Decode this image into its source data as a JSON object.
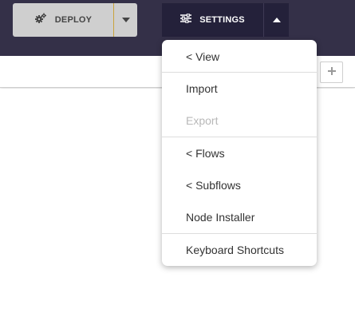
{
  "header": {
    "deploy": {
      "label": "DEPLOY",
      "icon": "gears-icon",
      "caret_icon": "caret-down-icon"
    },
    "settings": {
      "label": "SETTINGS",
      "icon": "sliders-icon",
      "caret_icon": "caret-up-icon"
    }
  },
  "tabs": {
    "add_icon": "plus-icon"
  },
  "menu": {
    "items": [
      {
        "label": "< View",
        "enabled": true
      },
      {
        "label": "Import",
        "enabled": true
      },
      {
        "label": "Export",
        "enabled": false
      },
      {
        "label": "< Flows",
        "enabled": true
      },
      {
        "label": "< Subflows",
        "enabled": true
      },
      {
        "label": "Node Installer",
        "enabled": true
      },
      {
        "label": "Keyboard Shortcuts",
        "enabled": true
      }
    ]
  },
  "colors": {
    "header_bg": "#343048",
    "settings_bg": "#24213a",
    "deploy_bg": "#cfcfcf",
    "deploy_accent": "#c9a23b",
    "menu_disabled_text": "#b8b8b8"
  }
}
